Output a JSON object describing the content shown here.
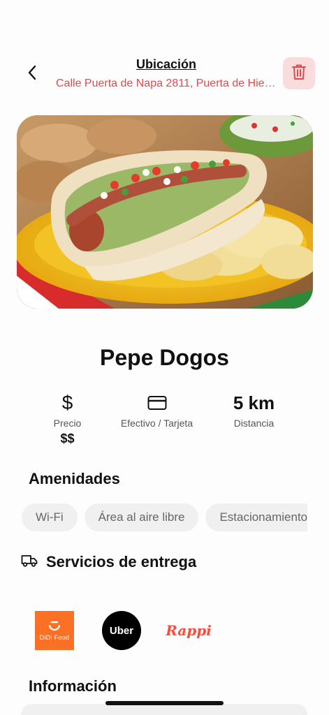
{
  "header": {
    "title": "Ubicación",
    "address": "Calle Puerta de Napa 2811, Puerta de Hierro"
  },
  "restaurant": {
    "name": "Pepe Dogos"
  },
  "info": {
    "price_label": "Precio",
    "price_value": "$$",
    "price_icon": "dollar-icon",
    "payment_label": "Efectivo / Tarjeta",
    "payment_icon": "credit-card-icon",
    "distance_value": "5 km",
    "distance_label": "Distancia"
  },
  "amenities": {
    "title": "Amenidades",
    "items": [
      "Wi-Fi",
      "Área al aire libre",
      "Estacionamiento"
    ]
  },
  "delivery": {
    "title": "Servicios de entrega",
    "icon": "truck-icon",
    "services": {
      "didi": "DiDi Food",
      "uber": "Uber",
      "rappi": "Rappi"
    }
  },
  "information": {
    "title": "Información"
  },
  "colors": {
    "accent_red": "#e2494b",
    "delete_bg": "#fbdcdc",
    "chip_bg": "#f0f0f0",
    "didi_orange": "#fb7025",
    "rappi_red": "#ff4b3a"
  }
}
